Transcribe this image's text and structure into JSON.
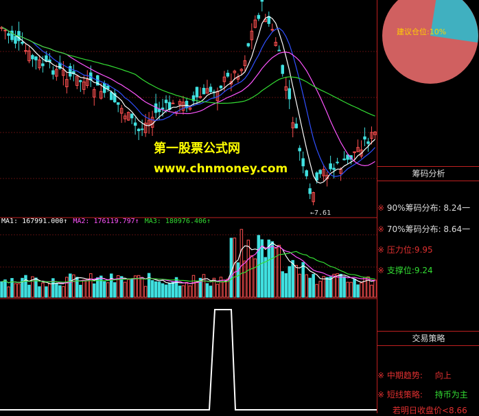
{
  "watermark": {
    "line1": "第一股票公式网",
    "line2": "www.chnmoney.com"
  },
  "price_chart": {
    "low_label": "←7.61"
  },
  "ma_legend": {
    "ma1": "MA1: 167991.000↑",
    "ma2": "MA2: 176119.797↑",
    "ma3": "MA3: 180976.406↑",
    "colors": {
      "ma1": "#ffffff",
      "ma2": "#ff55ff",
      "ma3": "#33dd33"
    }
  },
  "side": {
    "pie": {
      "label": "建议仓位:10%",
      "position_fraction": 0.1,
      "colors": {
        "main": "#d06060",
        "slice": "#40b0c0"
      }
    },
    "chip": {
      "title": "筹码分析",
      "rows": [
        {
          "star": "※",
          "text": "90%筹码分布: 8.24一"
        },
        {
          "star": "※",
          "text": "70%筹码分布: 8.64一"
        },
        {
          "star": "※",
          "text": "压力位:9.95"
        },
        {
          "star": "※",
          "text": "支撑位:9.24"
        }
      ]
    },
    "strategy": {
      "title": "交易策略",
      "rows": [
        {
          "star": "※",
          "label": "中期趋势:",
          "value": "向上"
        },
        {
          "star": "※",
          "label": "短线策略:",
          "value": "持币为主"
        }
      ],
      "footer": "若明日收盘价<8.66"
    }
  }
}
